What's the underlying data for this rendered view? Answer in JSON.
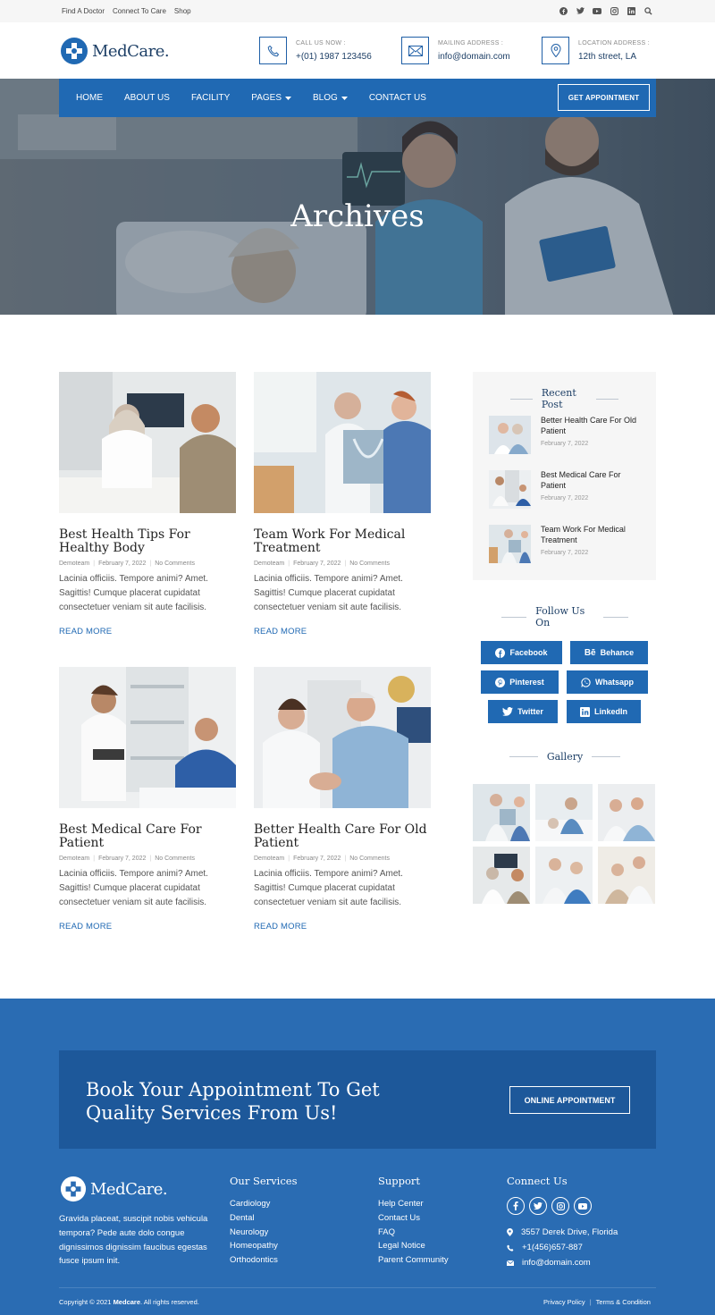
{
  "topbar": {
    "links": [
      "Find A Doctor",
      "Connect To Care",
      "Shop"
    ],
    "social_icons": [
      "facebook-icon",
      "twitter-icon",
      "youtube-icon",
      "instagram-icon",
      "linkedin-icon",
      "search-icon"
    ]
  },
  "header": {
    "logo": "MedCare.",
    "call_label": "CALL US NOW :",
    "call_value": "+(01) 1987 123456",
    "mail_label": "MAILING ADDRESS :",
    "mail_value": "info@domain.com",
    "location_label": "LOCATION ADDRESS :",
    "location_value": "12th street, LA"
  },
  "nav": {
    "items": [
      "HOME",
      "ABOUT US",
      "FACILITY",
      "PAGES",
      "BLOG",
      "CONTACT US"
    ],
    "cta": "GET APPOINTMENT"
  },
  "hero": {
    "title": "Archives"
  },
  "posts": [
    {
      "title": "Best Health Tips For Healthy Body",
      "author": "Demoteam",
      "date": "February 7, 2022",
      "comments": "No Comments",
      "excerpt": "Lacinia officiis. Tempore animi? Amet. Sagittis! Cumque placerat cupidatat consectetuer veniam sit aute facilisis.",
      "read_more": "READ MORE"
    },
    {
      "title": "Team Work For Medical Treatment",
      "author": "Demoteam",
      "date": "February 7, 2022",
      "comments": "No Comments",
      "excerpt": "Lacinia officiis. Tempore animi? Amet. Sagittis! Cumque placerat cupidatat consectetuer veniam sit aute facilisis.",
      "read_more": "READ MORE"
    },
    {
      "title": "Best Medical Care For Patient",
      "author": "Demoteam",
      "date": "February 7, 2022",
      "comments": "No Comments",
      "excerpt": "Lacinia officiis. Tempore animi? Amet. Sagittis! Cumque placerat cupidatat consectetuer veniam sit aute facilisis.",
      "read_more": "READ MORE"
    },
    {
      "title": "Better Health Care For Old Patient",
      "author": "Demoteam",
      "date": "February 7, 2022",
      "comments": "No Comments",
      "excerpt": "Lacinia officiis. Tempore animi? Amet. Sagittis! Cumque placerat cupidatat consectetuer veniam sit aute facilisis.",
      "read_more": "READ MORE"
    }
  ],
  "sidebar": {
    "recent_title": "Recent Post",
    "recent": [
      {
        "title": "Better Health Care For Old Patient",
        "date": "February 7, 2022"
      },
      {
        "title": "Best Medical Care For Patient",
        "date": "February 7, 2022"
      },
      {
        "title": "Team Work For Medical Treatment",
        "date": "February 7, 2022"
      }
    ],
    "follow_title": "Follow Us On",
    "follow": [
      "Facebook",
      "Behance",
      "Pinterest",
      "Whatsapp",
      "Twitter",
      "LinkedIn"
    ],
    "gallery_title": "Gallery"
  },
  "cta": {
    "text": "Book Your Appointment To Get Quality Services From Us!",
    "button": "ONLINE APPOINTMENT"
  },
  "footer": {
    "logo": "MedCare.",
    "about": "Gravida placeat, suscipit nobis vehicula tempora? Pede aute dolo congue dignissimos dignissim faucibus egestas fusce ipsum init.",
    "services_title": "Our Services",
    "services": [
      "Cardiology",
      "Dental",
      "Neurology",
      "Homeopathy",
      "Orthodontics"
    ],
    "support_title": "Support",
    "support": [
      "Help Center",
      "Contact Us",
      "FAQ",
      "Legal Notice",
      "Parent Community"
    ],
    "connect_title": "Connect Us",
    "address": "3557 Derek Drive, Florida",
    "phone": "+1(456)657-887",
    "email": "info@domain.com",
    "copyright_prefix": "Copyright © 2021 ",
    "copyright_brand": "Medcare",
    "copyright_suffix": ". All rights reserved.",
    "privacy": "Privacy Policy",
    "terms": "Terms & Condition"
  },
  "colors": {
    "primary": "#2069b3",
    "dark_blue": "#1d589a",
    "footer_blue": "#2a6cb3",
    "heading": "#1d3f66"
  }
}
